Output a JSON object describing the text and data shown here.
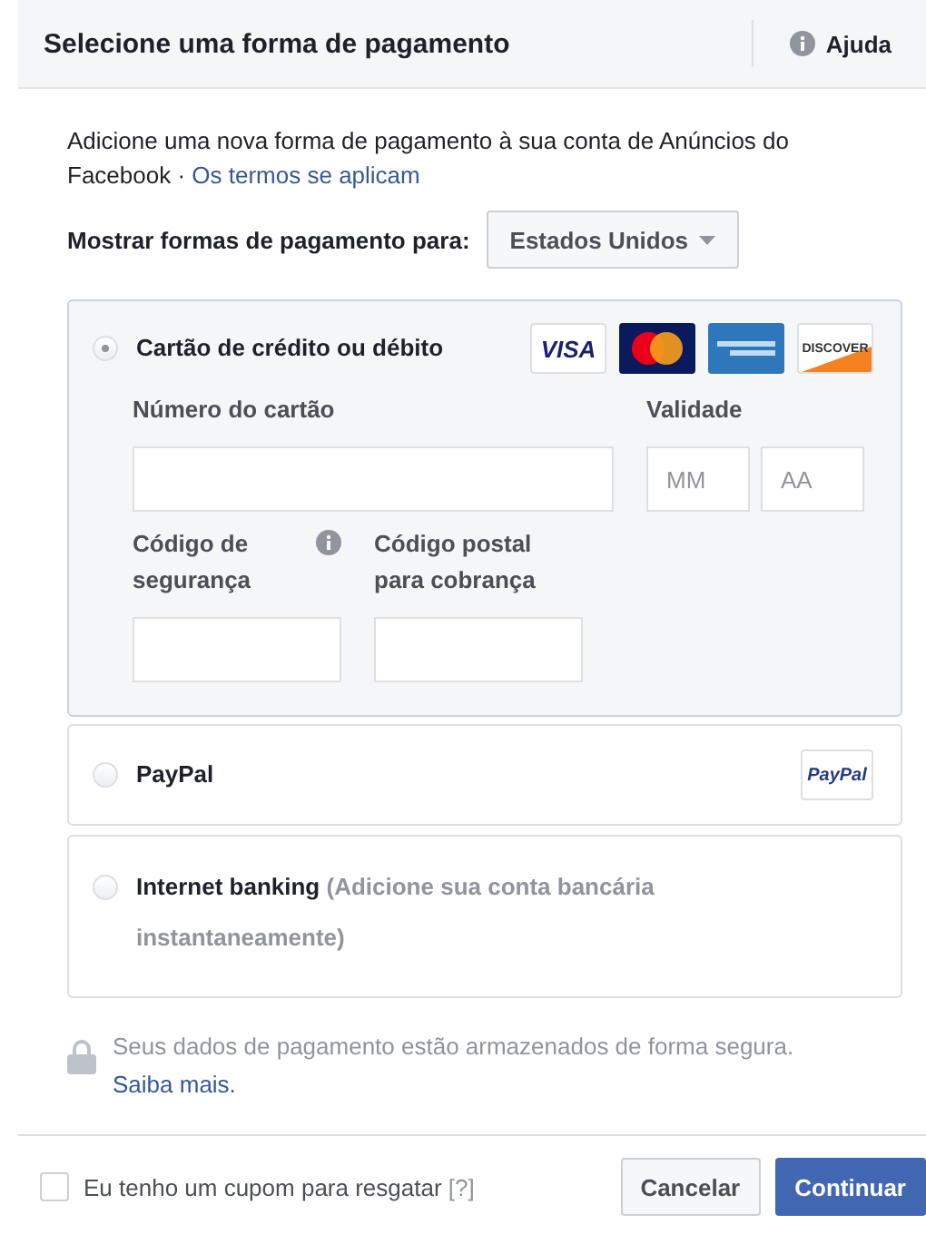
{
  "header": {
    "title": "Selecione uma forma de pagamento",
    "help": "Ajuda"
  },
  "intro": {
    "text": "Adicione uma nova forma de pagamento à sua conta de Anúncios do Facebook · ",
    "link": "Os termos se aplicam"
  },
  "country": {
    "label": "Mostrar formas de pagamento para:",
    "value": "Estados Unidos"
  },
  "methods": [
    {
      "kind": "card",
      "label": "Cartão de crédito ou débito",
      "selected": true,
      "logos": [
        {
          "kind": "visa",
          "text": "VISA"
        },
        {
          "kind": "mastercard"
        },
        {
          "kind": "amex"
        },
        {
          "kind": "discover",
          "text": "DISCOVER"
        }
      ],
      "fields": {
        "number_label": "Número do cartão",
        "expiry_label": "Validade",
        "month_placeholder": "MM",
        "year_placeholder": "AA",
        "cvc_label": "Código de segurança",
        "postal_label": "Código postal para cobrança"
      }
    },
    {
      "kind": "paypal",
      "label": "PayPal",
      "selected": false,
      "logo_text": "PayPal"
    },
    {
      "kind": "bank",
      "label": "Internet banking",
      "note": "(Adicione sua conta bancária instantaneamente)",
      "selected": false
    }
  ],
  "secure": {
    "text": "Seus dados de pagamento estão armazenados de forma segura.",
    "link": "Saiba mais."
  },
  "footer": {
    "coupon": {
      "label": "Eu tenho um cupom para resgatar",
      "hint": "[?]",
      "checked": false
    },
    "buttons": [
      {
        "kind": "secondary",
        "label": "Cancelar"
      },
      {
        "kind": "primary",
        "label": "Continuar"
      }
    ]
  }
}
